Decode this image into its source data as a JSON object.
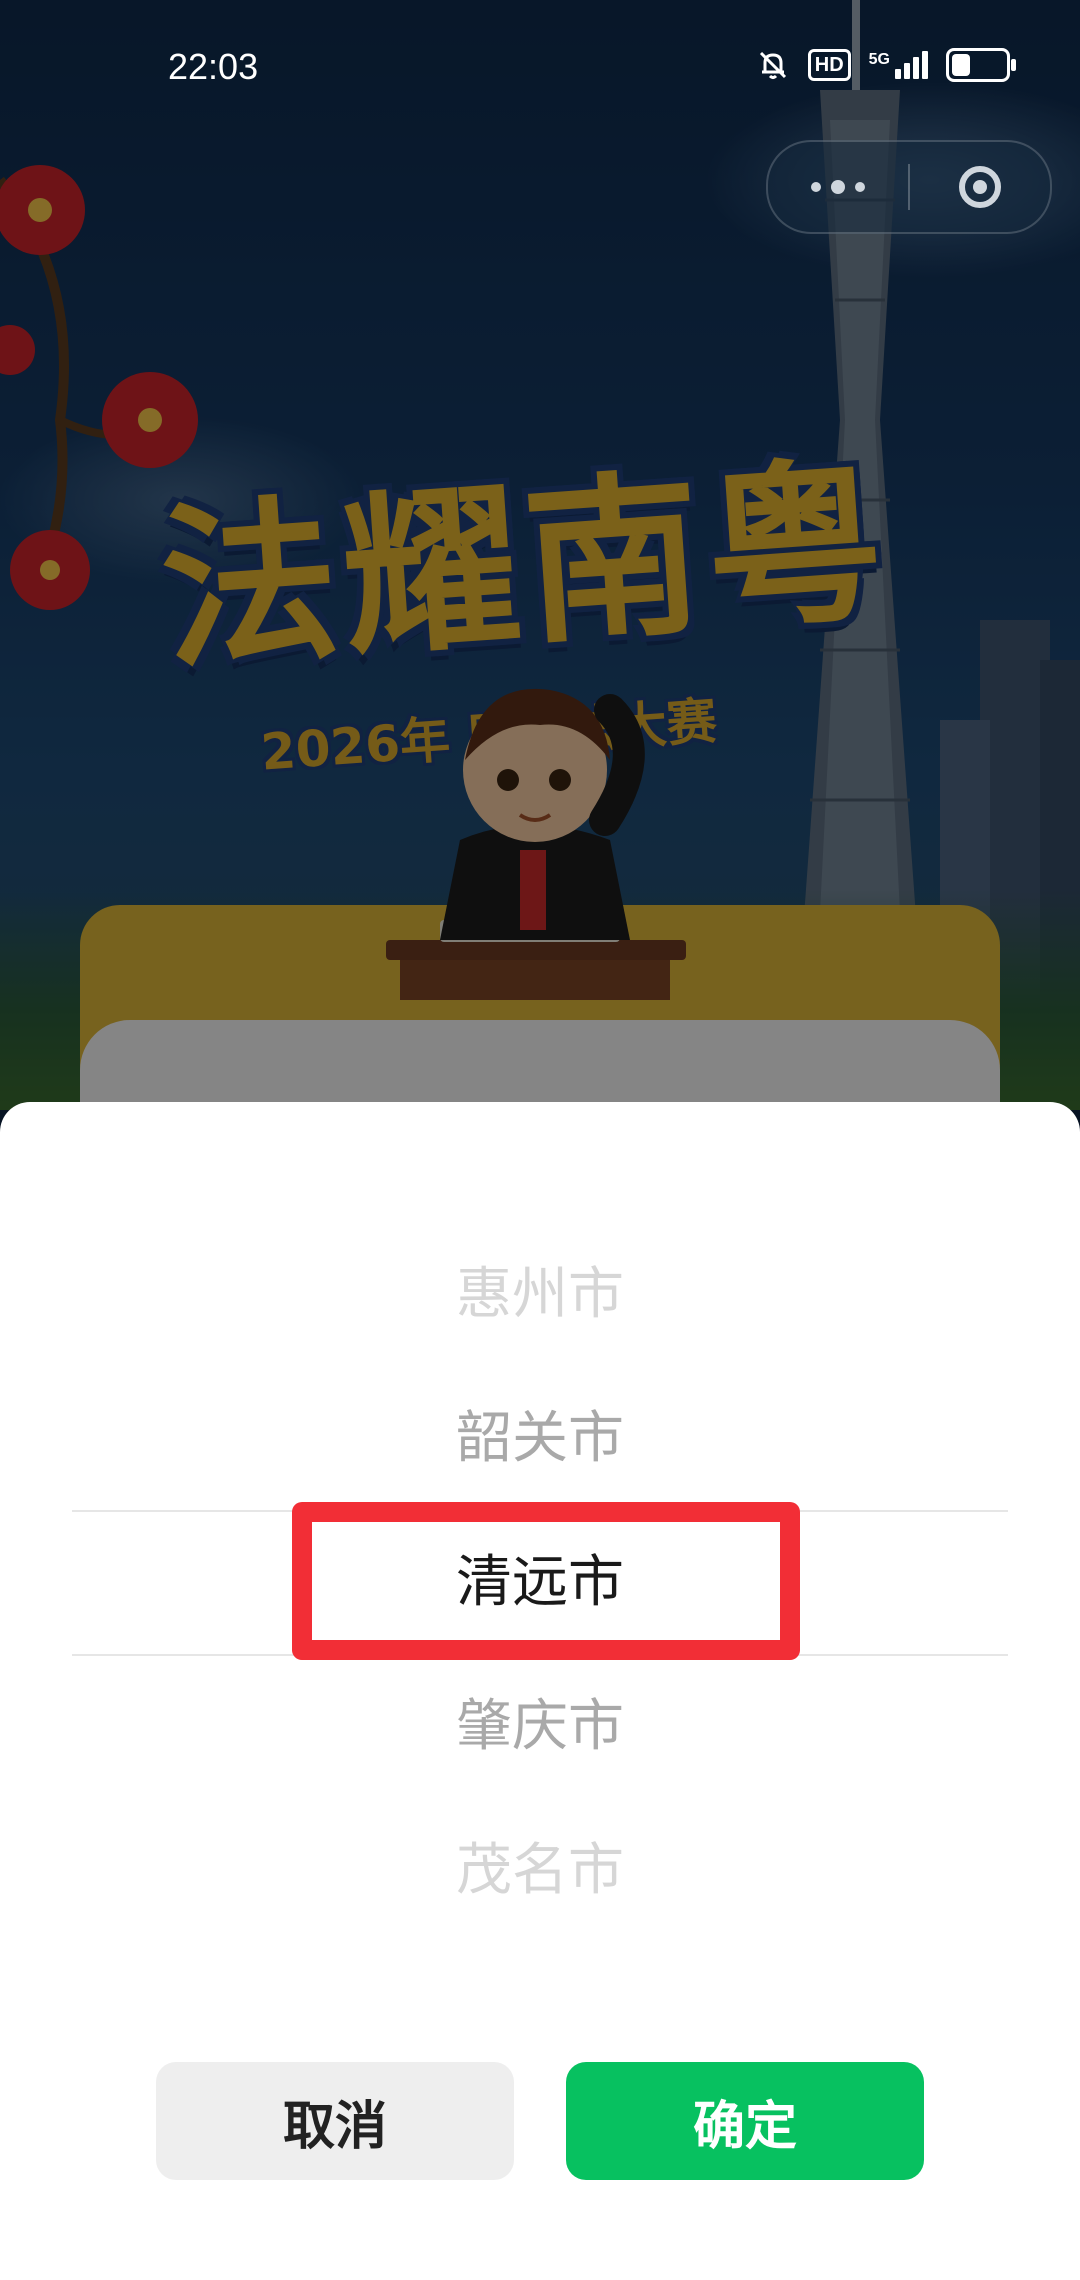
{
  "status_bar": {
    "time": "22:03",
    "hd": "HD",
    "network": "5G",
    "icons": [
      "bell-muted-icon",
      "hd-icon",
      "signal-icon",
      "battery-icon"
    ]
  },
  "capsule": {
    "menu_icon": "more-dots-icon",
    "close_icon": "target-close-icon"
  },
  "poster": {
    "title": "法耀南粤",
    "subtitle": "2026年        民普法大赛"
  },
  "picker": {
    "options": [
      "惠州市",
      "韶关市",
      "清远市",
      "肇庆市",
      "茂名市"
    ],
    "selected_index": 2
  },
  "buttons": {
    "cancel": "取消",
    "confirm": "确定"
  },
  "colors": {
    "confirm_green": "#07c160",
    "highlight_red": "#f22e36",
    "title_gold": "#e1b12e"
  }
}
